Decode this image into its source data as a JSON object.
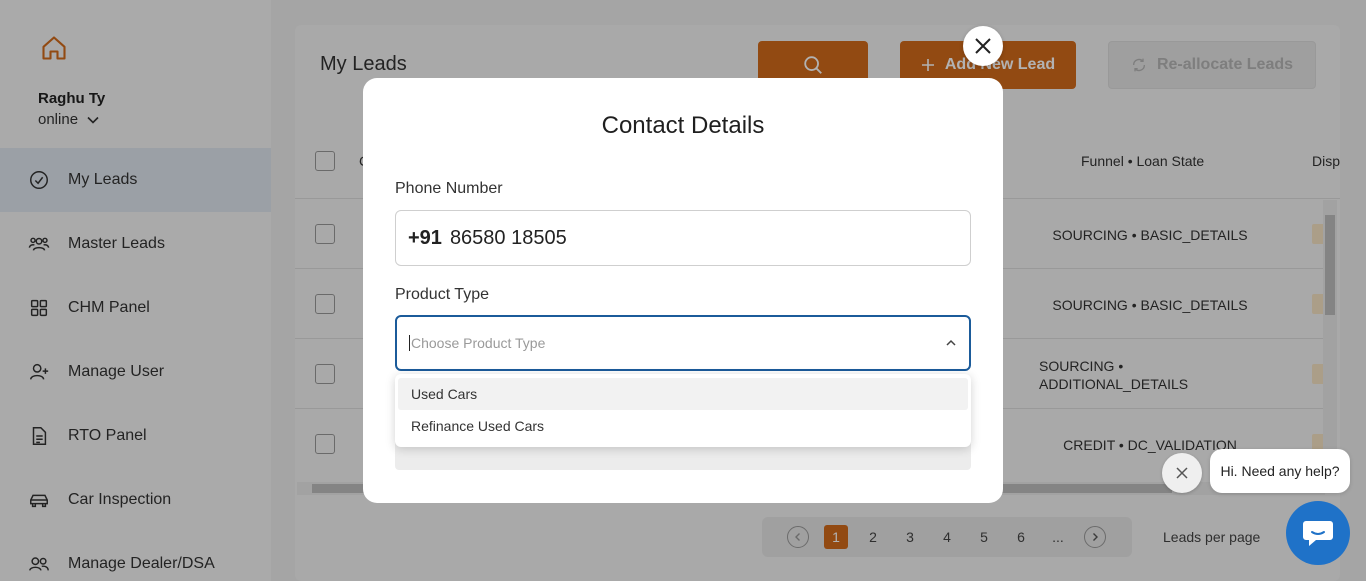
{
  "colors": {
    "accent": "#d26a1a",
    "focus_border": "#1b5b9a",
    "chat": "#1f72c8"
  },
  "sidebar": {
    "user": {
      "name": "Raghu Ty",
      "status": "online"
    },
    "items": [
      {
        "label": "My Leads",
        "icon": "check-circle-icon",
        "active": true
      },
      {
        "label": "Master Leads",
        "icon": "users-icon"
      },
      {
        "label": "CHM Panel",
        "icon": "grid-icon"
      },
      {
        "label": "Manage User",
        "icon": "user-plus-icon"
      },
      {
        "label": "RTO Panel",
        "icon": "document-icon"
      },
      {
        "label": "Car Inspection",
        "icon": "car-icon"
      },
      {
        "label": "Manage Dealer/DSA",
        "icon": "people-icon"
      }
    ]
  },
  "main": {
    "title": "My Leads",
    "add_lead_label": "Add New Lead",
    "reallocate_label": "Re-allocate Leads",
    "columns": {
      "col_c": "C",
      "funnel": "Funnel • Loan State",
      "disp": "Disp"
    },
    "rows": [
      {
        "funnel": "SOURCING • BASIC_DETAILS"
      },
      {
        "funnel": "SOURCING • BASIC_DETAILS"
      },
      {
        "funnel_line1": "SOURCING •",
        "funnel_line2": "ADDITIONAL_DETAILS"
      },
      {
        "funnel": "CREDIT • DC_VALIDATION"
      }
    ],
    "pagination": {
      "pages": [
        "1",
        "2",
        "3",
        "4",
        "5",
        "6",
        "..."
      ],
      "current": "1",
      "per_page_label": "Leads per page"
    }
  },
  "modal": {
    "title": "Contact Details",
    "phone_label": "Phone Number",
    "phone_code": "+91",
    "phone_value": "86580 18505",
    "product_label": "Product Type",
    "product_placeholder": "Choose Product Type",
    "product_options": [
      "Used Cars",
      "Refinance Used Cars"
    ]
  },
  "chat": {
    "greeting": "Hi. Need any help?"
  }
}
